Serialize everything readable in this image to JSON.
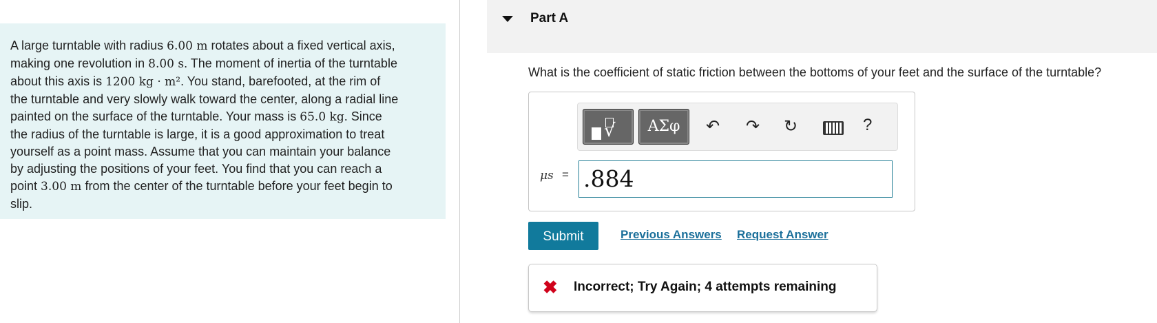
{
  "problem": {
    "lines": [
      {
        "t1": "A large turntable with radius ",
        "m1": "6.00 m",
        "t2": " rotates about a fixed vertical axis,"
      },
      {
        "t1": "making one revolution in ",
        "m1": "8.00 s",
        "t2": ". The moment of inertia of the turntable"
      },
      {
        "t1": "about this axis is ",
        "m1": "1200 kg · m²",
        "t2": ". You stand, barefooted, at the rim of"
      },
      {
        "t1": "the turntable and very slowly walk toward the center, along a radial line",
        "m1": "",
        "t2": ""
      },
      {
        "t1": "painted on the surface of the turntable. Your mass is ",
        "m1": "65.0 kg",
        "t2": ". Since"
      },
      {
        "t1": "the radius of the turntable is large, it is a good approximation to treat",
        "m1": "",
        "t2": ""
      },
      {
        "t1": "yourself as a point mass. Assume that you can maintain your balance",
        "m1": "",
        "t2": ""
      },
      {
        "t1": "by adjusting the positions of your feet. You find that you can reach a",
        "m1": "",
        "t2": ""
      },
      {
        "t1": "point ",
        "m1": "3.00 m",
        "t2": " from the center of the turntable before your feet begin to"
      },
      {
        "t1": "slip.",
        "m1": "",
        "t2": ""
      }
    ]
  },
  "part": {
    "title": "Part A",
    "question": "What is the coefficient of static friction between the bottoms of your feet and the surface of the turntable?"
  },
  "toolbar": {
    "template_root_glyph": "√",
    "greek_label": "ΑΣφ",
    "undo_glyph": "↶",
    "redo_glyph": "↷",
    "reset_glyph": "↻",
    "help_label": "?"
  },
  "answer": {
    "variable": "μs",
    "equals": "=",
    "value": ".884"
  },
  "buttons": {
    "submit": "Submit",
    "previous_answers": "Previous Answers",
    "request_answer": "Request Answer"
  },
  "feedback": {
    "icon": "✖",
    "message": "Incorrect; Try Again; 4 attempts remaining",
    "status_color": "#d0021b"
  },
  "colors": {
    "problem_bg": "#e6f4f5",
    "accent": "#117a9c",
    "link": "#1a6f9a"
  }
}
